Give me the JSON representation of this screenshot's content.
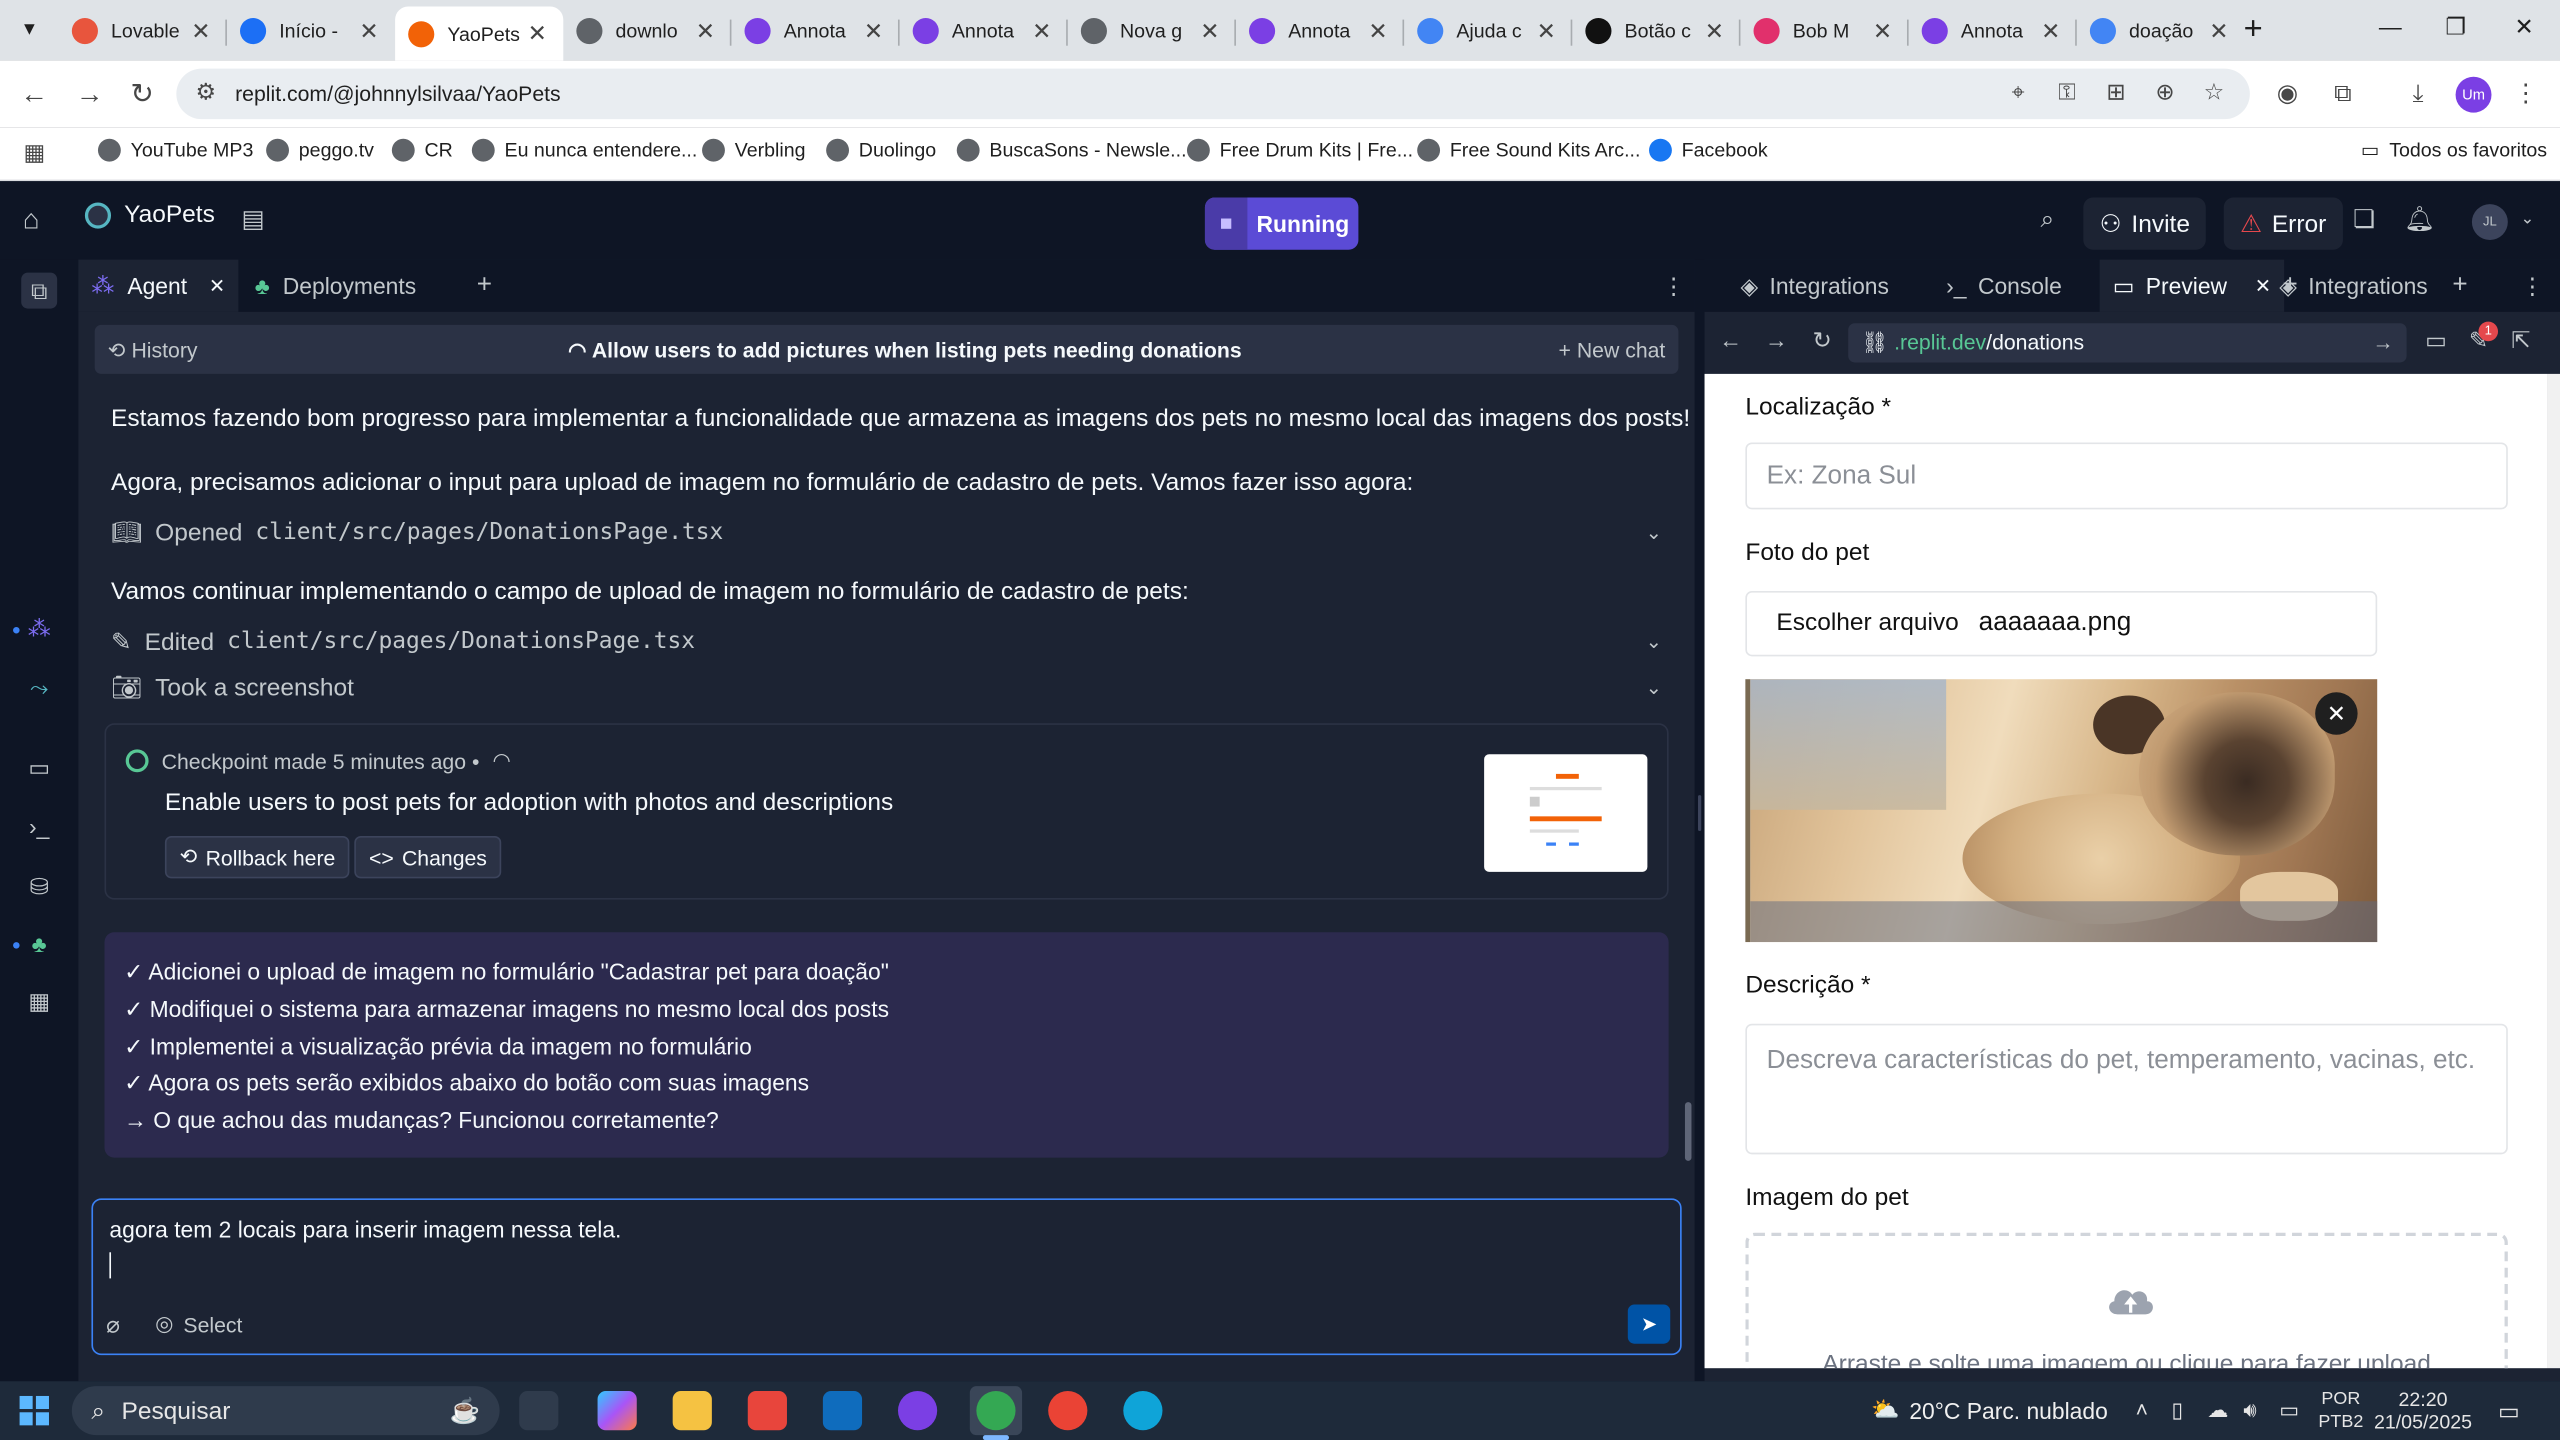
{
  "browser": {
    "tabs": [
      {
        "title": "Lovable",
        "color": "#e8553d"
      },
      {
        "title": "Início -",
        "color": "#1c6ff5"
      },
      {
        "title": "YaoPets",
        "color": "#f26207",
        "active": true
      },
      {
        "title": "downlo",
        "color": "#5f6368"
      },
      {
        "title": "Annota",
        "color": "#7b3fe4"
      },
      {
        "title": "Annota",
        "color": "#7b3fe4"
      },
      {
        "title": "Nova g",
        "color": "#5f6368"
      },
      {
        "title": "Annota",
        "color": "#7b3fe4"
      },
      {
        "title": "Ajuda c",
        "color": "#4285f4"
      },
      {
        "title": "Botão c",
        "color": "#111111"
      },
      {
        "title": "Bob M",
        "color": "#e1306c"
      },
      {
        "title": "Annota",
        "color": "#7b3fe4"
      },
      {
        "title": "doação",
        "color": "#4285f4"
      }
    ],
    "url": "replit.com/@johnnylsilvaa/YaoPets",
    "bookmarks": [
      "YouTube MP3",
      "peggo.tv",
      "CR",
      "Eu nunca entendere...",
      "Verbling",
      "Duolingo",
      "BuscaSons - Newsle...",
      "Free Drum Kits | Fre...",
      "Free Sound Kits Arc...",
      "Facebook"
    ],
    "all_bookmarks": "Todos os favoritos",
    "profile_initials": "Um"
  },
  "replit": {
    "project_name": "YaoPets",
    "run_label": "Running",
    "invite_label": "Invite",
    "error_label": "Error",
    "avatar_initials": "JL",
    "left_tabs": {
      "agent": "Agent",
      "deployments": "Deployments"
    },
    "history_label": "History",
    "thread_title": "Allow users to add pictures when listing pets needing donations",
    "new_chat_label": "New chat",
    "messages": {
      "m1": "Estamos fazendo bom progresso para implementar a funcionalidade que armazena as imagens dos pets no mesmo local das imagens dos posts!",
      "m2": "Agora, precisamos adicionar o input para upload de imagem no formulário de cadastro de pets. Vamos fazer isso agora:",
      "m3": "Vamos continuar implementando o campo de upload de imagem no formulário de cadastro de pets:"
    },
    "actions": {
      "opened_label": "Opened",
      "opened_file": "client/src/pages/DonationsPage.tsx",
      "edited_label": "Edited",
      "edited_file": "client/src/pages/DonationsPage.tsx",
      "screenshot": "Took a screenshot"
    },
    "checkpoint": {
      "header": "Checkpoint made 5 minutes ago •",
      "description": "Enable users to post pets for adoption with photos and descriptions",
      "rollback": "Rollback here",
      "changes": "Changes"
    },
    "summary": [
      "✓ Adicionei o upload de imagem no formulário \"Cadastrar pet para doação\"",
      "✓ Modifiquei o sistema para armazenar imagens no mesmo local dos posts",
      "✓ Implementei a visualização prévia da imagem no formulário",
      "✓ Agora os pets serão exibidos abaixo do botão com suas imagens",
      "→ O que achou das mudanças? Funcionou corretamente?"
    ],
    "composer": {
      "text": "agora tem 2 locais para inserir imagem nessa tela.",
      "select_label": "Select"
    },
    "right_tabs": {
      "integrations": "Integrations",
      "console": "Console",
      "preview": "Preview",
      "integrations2": "Integrations"
    },
    "preview_url_host": ".replit.dev",
    "preview_url_path": "/donations",
    "badge_count": "1"
  },
  "preview_page": {
    "location_label": "Localização *",
    "location_placeholder": "Ex: Zona Sul",
    "photo_label": "Foto do pet",
    "choose_file": "Escolher arquivo",
    "file_name": "aaaaaaa.png",
    "description_label": "Descrição *",
    "description_placeholder": "Descreva características do pet, temperamento, vacinas, etc.",
    "image_label": "Imagem do pet",
    "dropzone_text": "Arraste e solte uma imagem ou clique para fazer upload"
  },
  "taskbar": {
    "search_placeholder": "Pesquisar",
    "weather": "20°C  Parc. nublado",
    "lang_top": "POR",
    "lang_bottom": "PTB2",
    "time": "22:20",
    "date": "21/05/2025"
  }
}
